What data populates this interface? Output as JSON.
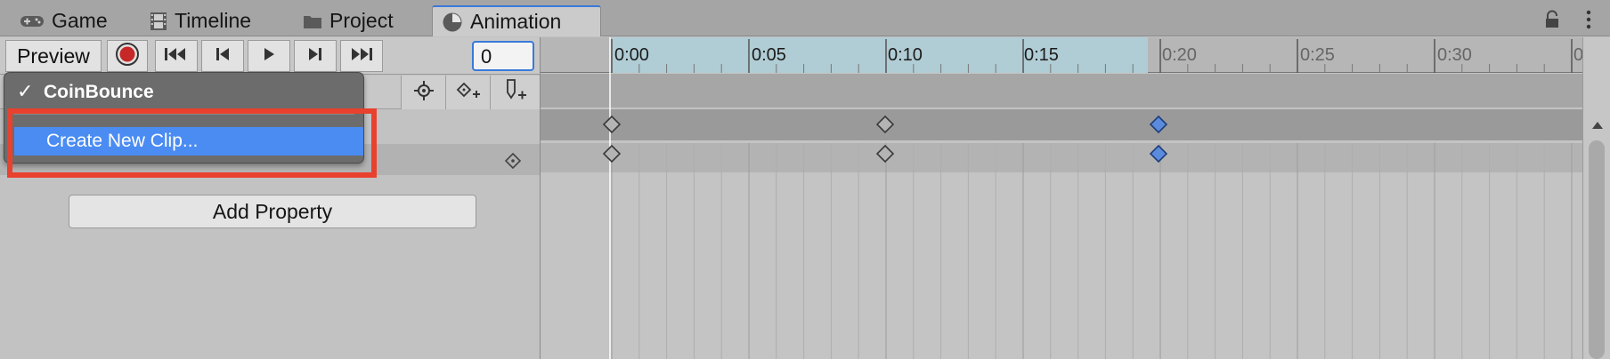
{
  "tabs": {
    "game": "Game",
    "timeline": "Timeline",
    "project": "Project",
    "animation": "Animation"
  },
  "toolbar": {
    "preview_label": "Preview",
    "frame_value": "0"
  },
  "ruler": {
    "labels": [
      "0:00",
      "0:05",
      "0:10",
      "0:15",
      "0:20",
      "0:25",
      "0:30",
      "0"
    ]
  },
  "dropdown": {
    "check": "✓",
    "selected_clip": "CoinBounce",
    "create_new_clip": "Create New Clip..."
  },
  "left_panel": {
    "add_property_label": "Add Property"
  },
  "colors": {
    "accent_blue": "#4a8cf2",
    "highlight_red": "#e8412d",
    "selected_keyframe": "#5b8bdc",
    "record_red": "#c62828"
  },
  "icons": {
    "game_tab": "gamepad-icon",
    "timeline_tab": "film-icon",
    "project_tab": "folder-icon",
    "animation_tab": "clock-icon",
    "lock": "lock-icon",
    "menu": "kebab-icon"
  }
}
